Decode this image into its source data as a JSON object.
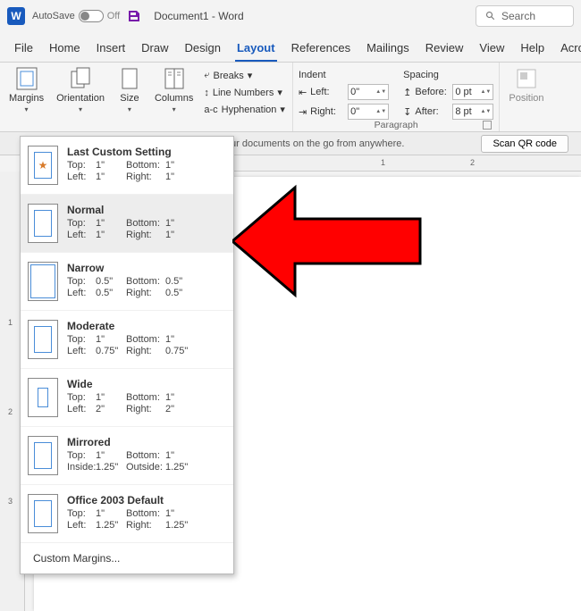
{
  "titlebar": {
    "autosave_label": "AutoSave",
    "autosave_state": "Off",
    "doc_title": "Document1 - Word",
    "search_placeholder": "Search"
  },
  "tabs": [
    "File",
    "Home",
    "Insert",
    "Draw",
    "Design",
    "Layout",
    "References",
    "Mailings",
    "Review",
    "View",
    "Help",
    "Acro"
  ],
  "active_tab": "Layout",
  "ribbon": {
    "page_setup": {
      "margins": "Margins",
      "orientation": "Orientation",
      "size": "Size",
      "columns": "Columns",
      "breaks": "Breaks",
      "line_numbers": "Line Numbers",
      "hyphenation": "Hyphenation"
    },
    "paragraph": {
      "indent_label": "Indent",
      "spacing_label": "Spacing",
      "left_label": "Left:",
      "right_label": "Right:",
      "before_label": "Before:",
      "after_label": "After:",
      "left_val": "0\"",
      "right_val": "0\"",
      "before_val": "0 pt",
      "after_val": "8 pt",
      "group_label": "Paragraph"
    },
    "arrange": {
      "position": "Position"
    }
  },
  "infobar": {
    "text": "ur documents on the go from anywhere.",
    "qr": "Scan QR code"
  },
  "ruler_numbers_h": [
    "1",
    "2"
  ],
  "ruler_numbers_v": [
    "1",
    "2",
    "3"
  ],
  "margins_menu": {
    "items": [
      {
        "name": "Last Custom Setting",
        "top": "1\"",
        "bottom": "1\"",
        "left": "1\"",
        "right": "1\"",
        "left_label": "Left:",
        "right_label": "Right:",
        "star": true
      },
      {
        "name": "Normal",
        "top": "1\"",
        "bottom": "1\"",
        "left": "1\"",
        "right": "1\"",
        "left_label": "Left:",
        "right_label": "Right:"
      },
      {
        "name": "Narrow",
        "top": "0.5\"",
        "bottom": "0.5\"",
        "left": "0.5\"",
        "right": "0.5\"",
        "left_label": "Left:",
        "right_label": "Right:"
      },
      {
        "name": "Moderate",
        "top": "1\"",
        "bottom": "1\"",
        "left": "0.75\"",
        "right": "0.75\"",
        "left_label": "Left:",
        "right_label": "Right:"
      },
      {
        "name": "Wide",
        "top": "1\"",
        "bottom": "1\"",
        "left": "2\"",
        "right": "2\"",
        "left_label": "Left:",
        "right_label": "Right:"
      },
      {
        "name": "Mirrored",
        "top": "1\"",
        "bottom": "1\"",
        "left": "1.25\"",
        "right": "1.25\"",
        "left_label": "Inside:",
        "right_label": "Outside:"
      },
      {
        "name": "Office 2003 Default",
        "top": "1\"",
        "bottom": "1\"",
        "left": "1.25\"",
        "right": "1.25\"",
        "left_label": "Left:",
        "right_label": "Right:"
      }
    ],
    "selected_index": 1,
    "custom": "Custom Margins...",
    "labels": {
      "top": "Top:",
      "bottom": "Bottom:"
    }
  }
}
